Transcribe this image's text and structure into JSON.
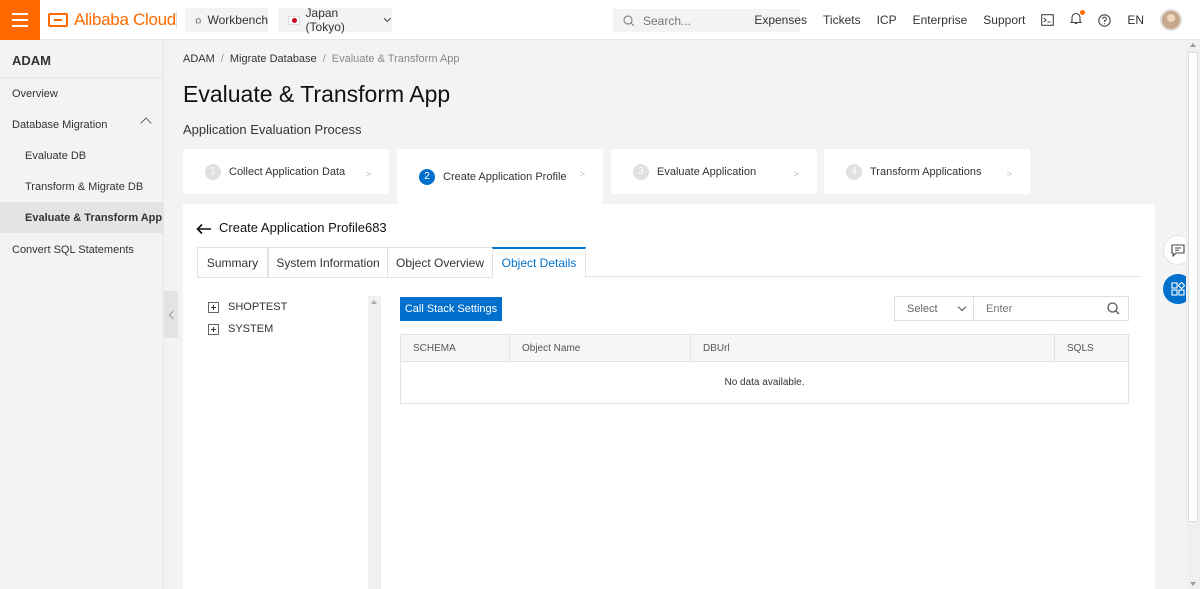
{
  "topbar": {
    "logo_text": "Alibaba Cloud",
    "workbench_label": "Workbench",
    "region_label": "Japan (Tokyo)",
    "search_placeholder": "Search...",
    "links": [
      "Expenses",
      "Tickets",
      "ICP",
      "Enterprise",
      "Support"
    ],
    "language": "EN",
    "accent_color": "#ff6a00"
  },
  "sidebar": {
    "title": "ADAM",
    "items": [
      {
        "label": "Overview"
      },
      {
        "label": "Database Migration"
      },
      {
        "label": "Evaluate DB"
      },
      {
        "label": "Transform & Migrate DB"
      },
      {
        "label": "Evaluate & Transform App"
      },
      {
        "label": "Convert SQL Statements"
      }
    ]
  },
  "breadcrumb": [
    "ADAM",
    "Migrate Database",
    "Evaluate & Transform App"
  ],
  "page_title": "Evaluate & Transform App",
  "sub_title": "Application Evaluation Process",
  "steps": [
    {
      "num": "1",
      "label": "Collect Application Data"
    },
    {
      "num": "2",
      "label": "Create Application Profile"
    },
    {
      "num": "3",
      "label": "Evaluate Application"
    },
    {
      "num": "4",
      "label": "Transform Applications"
    }
  ],
  "panel": {
    "title": "Create Application Profile683",
    "tabs": [
      "Summary",
      "System Information",
      "Object Overview",
      "Object Details"
    ],
    "tree": [
      "SHOPTEST",
      "SYSTEM"
    ],
    "call_stack_button": "Call Stack Settings",
    "select_placeholder": "Select",
    "filter_placeholder": "Enter",
    "table_headers": [
      "SCHEMA",
      "Object Name",
      "DBUrl",
      "SQLS"
    ],
    "empty_text": "No data available."
  },
  "primary_color": "#0070cc"
}
